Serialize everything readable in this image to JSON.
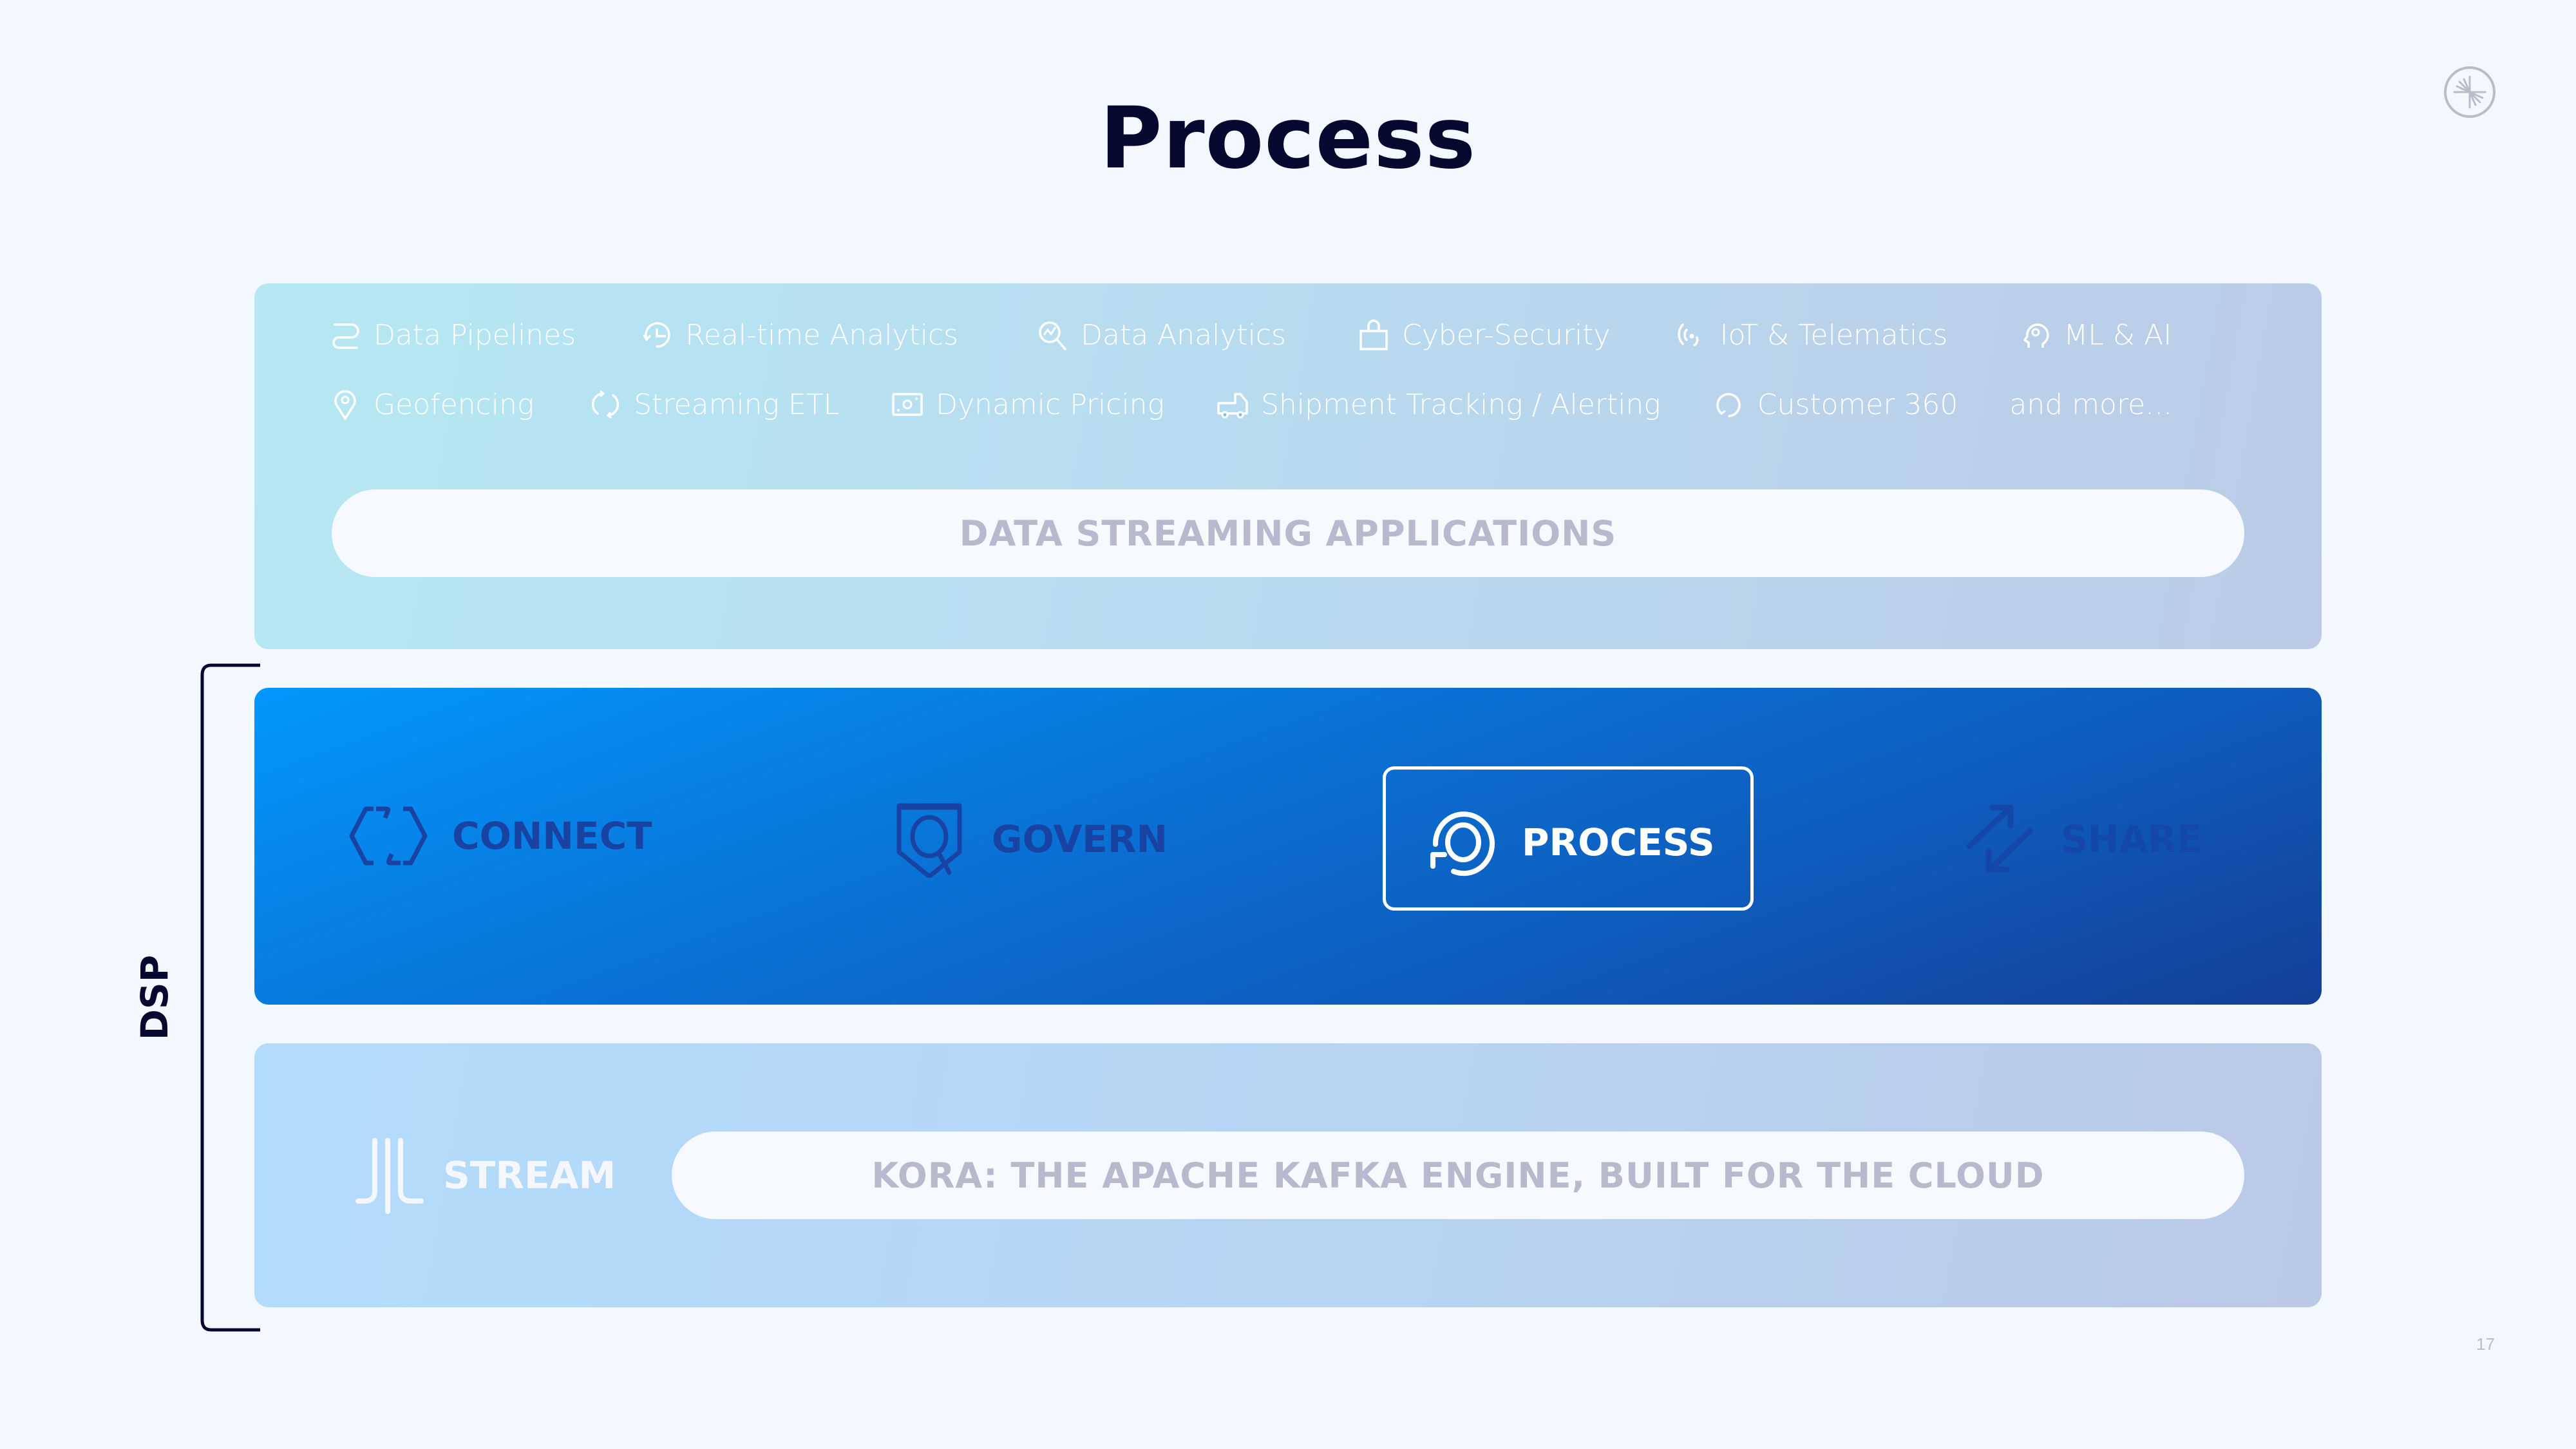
{
  "slide": {
    "title": "Process",
    "page_number": "17",
    "logo_icon": "confluent-logo-icon"
  },
  "applications": {
    "row1": [
      {
        "label": "Data Pipelines",
        "icon": "pipeline-icon"
      },
      {
        "label": "Real-time Analytics",
        "icon": "clock-refresh-icon"
      },
      {
        "label": "Data Analytics",
        "icon": "magnifier-chart-icon"
      },
      {
        "label": "Cyber-Security",
        "icon": "lock-icon"
      },
      {
        "label": "IoT & Telematics",
        "icon": "signal-icon"
      },
      {
        "label": "ML & AI",
        "icon": "head-brain-icon"
      }
    ],
    "row2": [
      {
        "label": "Geofencing",
        "icon": "map-pin-icon"
      },
      {
        "label": "Streaming ETL",
        "icon": "cycle-arrows-icon"
      },
      {
        "label": "Dynamic Pricing",
        "icon": "price-tag-icon"
      },
      {
        "label": "Shipment Tracking / Alerting",
        "icon": "truck-icon"
      },
      {
        "label": "Customer 360",
        "icon": "circular-arrow-icon"
      },
      {
        "label": "and more...",
        "icon": ""
      }
    ],
    "pill_label": "DATA STREAMING APPLICATIONS"
  },
  "dsp": {
    "label": "DSP",
    "capabilities": [
      {
        "label": "CONNECT",
        "icon": "hexagon-connector-icon",
        "active": false
      },
      {
        "label": "GOVERN",
        "icon": "shield-magnifier-icon",
        "active": false
      },
      {
        "label": "PROCESS",
        "icon": "process-cycle-icon",
        "active": true
      },
      {
        "label": "SHARE",
        "icon": "exchange-arrows-icon",
        "active": false
      }
    ]
  },
  "stream": {
    "label": "STREAM",
    "icon": "stream-lines-icon",
    "pill_label": "KORA: THE APACHE KAFKA ENGINE, BUILT FOR THE CLOUD"
  },
  "colors": {
    "title": "#070830",
    "active_accent": "#ffffff",
    "inactive_capability": "#1843a3",
    "pill_text": "#b8b9cc"
  }
}
